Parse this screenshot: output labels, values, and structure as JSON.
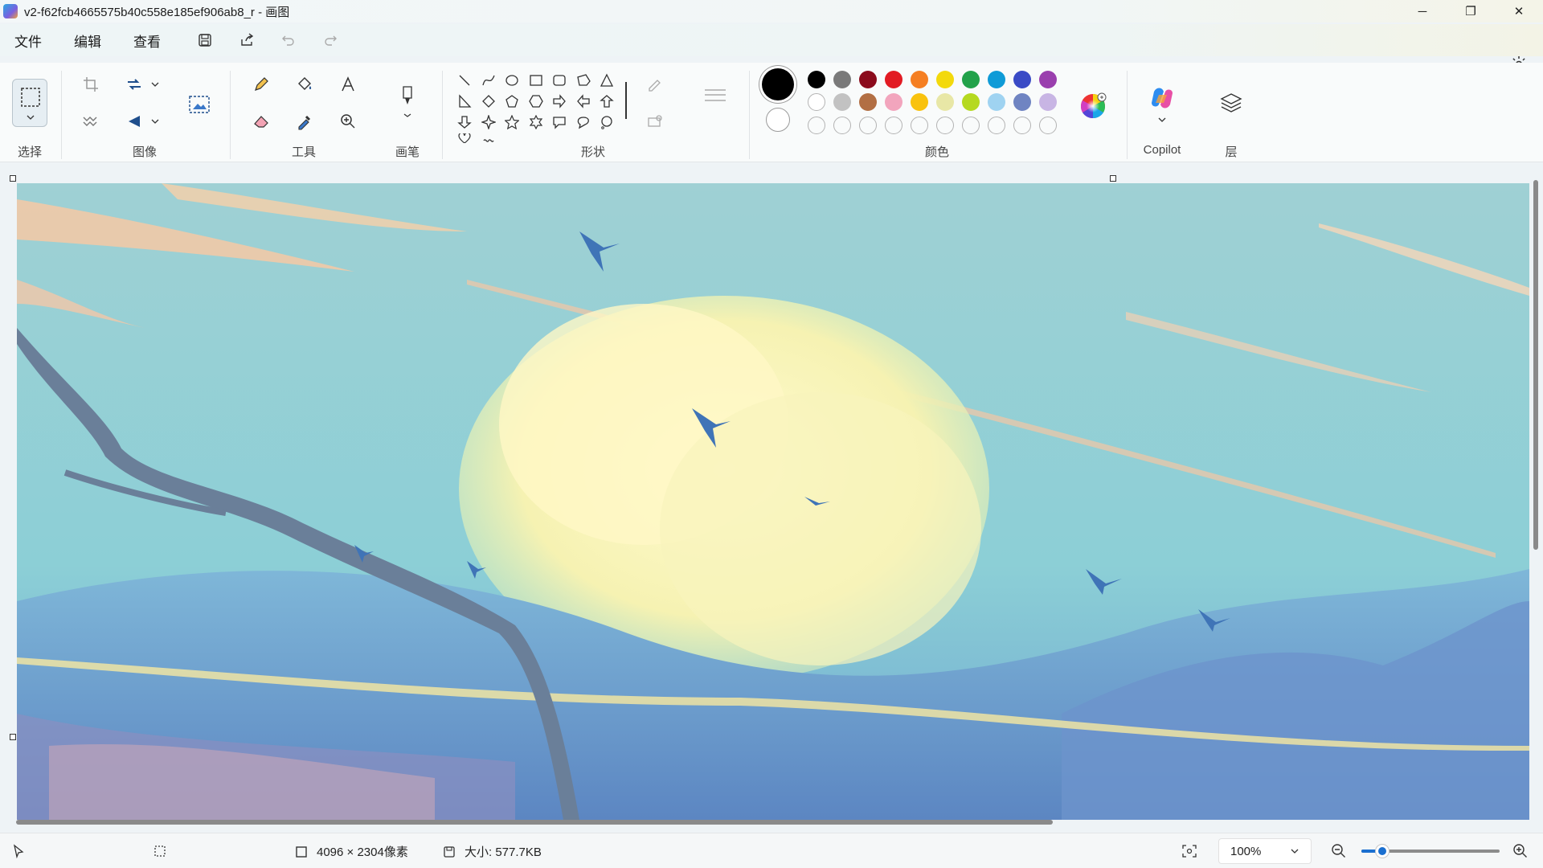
{
  "window": {
    "title": "v2-f62fcb4665575b40c558e185ef906ab8_r - 画图",
    "minimize": "─",
    "restore": "❐",
    "close": "✕"
  },
  "menu": {
    "file": "文件",
    "edit": "编辑",
    "view": "查看"
  },
  "quick_access": [
    "save-icon",
    "share-icon",
    "undo-icon",
    "redo-icon"
  ],
  "ribbon": {
    "groups": {
      "select": "选择",
      "image": "图像",
      "tools": "工具",
      "brushes": "画笔",
      "shapes": "形状",
      "colors": "颜色",
      "copilot": "Copilot",
      "layers": "层"
    },
    "current_colors": {
      "primary": "#000000",
      "secondary": "#ffffff"
    },
    "palette_row1": [
      "#000000",
      "#7a7a7a",
      "#8b0b1c",
      "#e21b23",
      "#f57f22",
      "#f3d90c",
      "#22a24a",
      "#0f9bd7",
      "#3a4bc6",
      "#9a3fae"
    ],
    "palette_row2": [
      "#ffffff",
      "#c2c2c2",
      "#b26f44",
      "#f2a5bd",
      "#f9c20e",
      "#e8e7a6",
      "#b5d920",
      "#9fd3f1",
      "#6f84c2",
      "#c8b5e4"
    ],
    "palette_row3_count": 10
  },
  "status": {
    "dimensions": "4096 × 2304像素",
    "size": "大小: 577.7KB",
    "zoom": "100%",
    "zoom_fraction": 0.15
  }
}
